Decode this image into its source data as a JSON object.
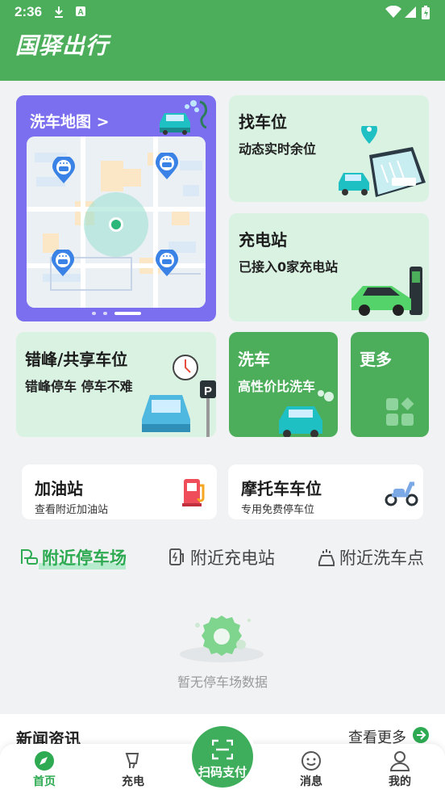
{
  "status_bar": {
    "time": "2:36"
  },
  "app": {
    "title": "国驿出行"
  },
  "cards": {
    "wash_map": {
      "title": "洗车地图 >"
    },
    "find_spot": {
      "title": "找车位",
      "subtitle": "动态实时余位"
    },
    "charging": {
      "title": "充电站",
      "subtitle": "已接入0家充电站"
    },
    "shared_spot": {
      "title": "错峰/共享车位",
      "subtitle": "错峰停车  停车不难"
    },
    "car_wash": {
      "title": "洗车",
      "subtitle": "高性价比洗车"
    },
    "more": {
      "title": "更多"
    }
  },
  "quick_links": [
    {
      "title": "加油站",
      "subtitle": "查看附近加油站"
    },
    {
      "title": "摩托车车位",
      "subtitle": "专用免费停车位"
    }
  ],
  "nearby_tabs": [
    {
      "label": "附近停车场"
    },
    {
      "label": "附近充电站"
    },
    {
      "label": "附近洗车点"
    }
  ],
  "empty_state": {
    "text": "暂无停车场数据"
  },
  "news": {
    "title": "新闻资讯",
    "more": "查看更多"
  },
  "bottom_nav": {
    "home": "首页",
    "charge": "充电",
    "scan": "扫码支付",
    "messages": "消息",
    "mine": "我的"
  },
  "colors": {
    "brand_green": "#4cae5b",
    "accent_green": "#2eab52",
    "map_purple": "#7b6ff0",
    "card_green": "#d9f2e2"
  }
}
